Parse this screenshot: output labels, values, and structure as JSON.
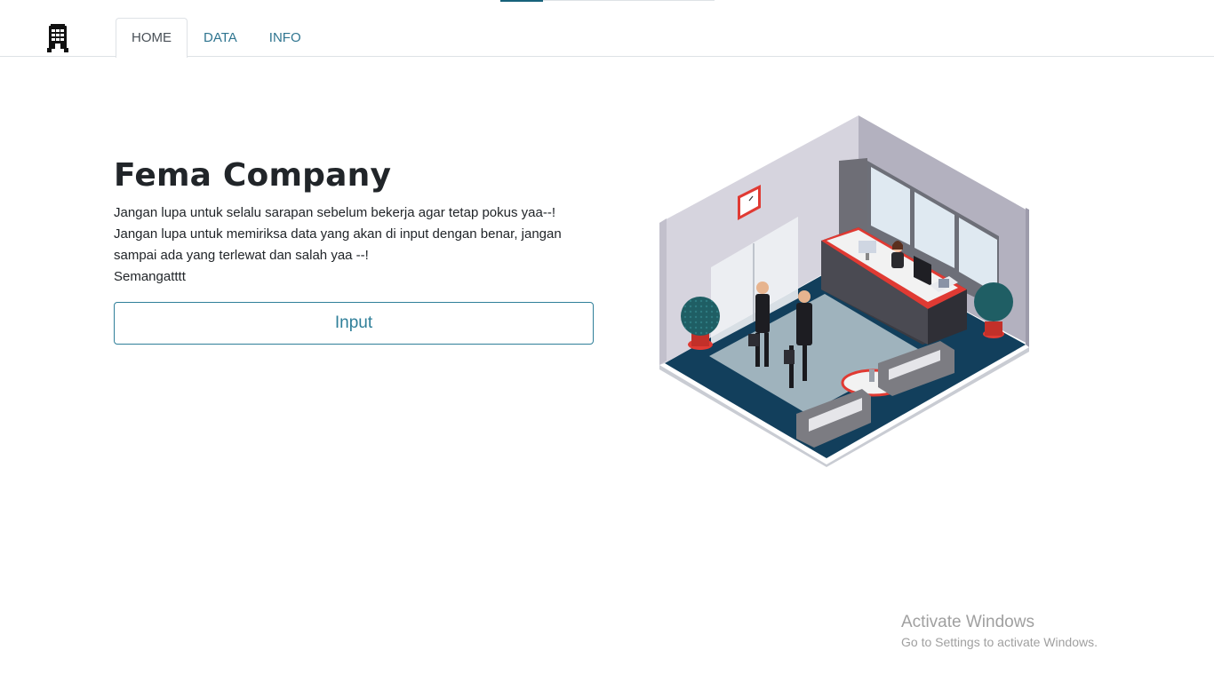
{
  "loading_bar": {
    "progress": 0.2
  },
  "brand": {
    "icon": "building-icon"
  },
  "nav": {
    "tabs": [
      {
        "label": "HOME",
        "active": true
      },
      {
        "label": "DATA",
        "active": false
      },
      {
        "label": "INFO",
        "active": false
      }
    ]
  },
  "hero": {
    "title": "Fema Company",
    "lines": [
      "Jangan lupa untuk selalu sarapan sebelum bekerja agar tetap pokus yaa--!",
      "Jangan lupa untuk memiriksa data yang akan di input dengan benar, jangan sampai ada yang terlewat dan salah yaa --!",
      "Semangatttt"
    ],
    "button_label": "Input"
  },
  "illustration": {
    "name": "isometric-office-lobby-illustration"
  },
  "watermark": {
    "title": "Activate Windows",
    "subtitle": "Go to Settings to activate Windows."
  },
  "colors": {
    "accent": "#2f7f99",
    "carpet": "#123f5c",
    "desk_red": "#e03a33"
  }
}
